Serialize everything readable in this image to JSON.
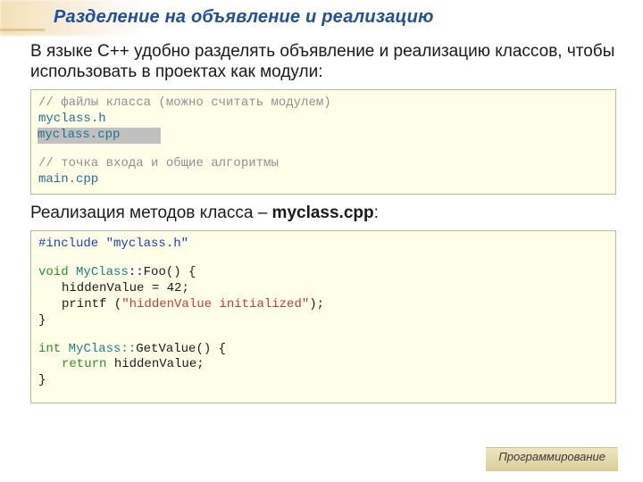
{
  "title": "Разделение на объявление и реализацию",
  "intro": "В языке С++ удобно разделять объявление и реализацию классов, чтобы использовать в проектах как модули:",
  "box1": {
    "comment1": "// файлы класса (можно считать модулем)",
    "file_h": "myclass.h",
    "file_cpp": "myclass.cpp",
    "comment2": "// точка входа и общие алгоритмы",
    "main": "main.cpp"
  },
  "mid_pre": "Реализация методов класса – ",
  "mid_bold": "myclass.cpp",
  "mid_post": ":",
  "box2": {
    "include": "#include \"myclass.h\"",
    "sig1_kw": "void",
    "sig1_class": "MyClass",
    "sig1_sep": "::",
    "sig1_fn": "Foo() {",
    "body1a_l": "hiddenValue = ",
    "body1a_n": "42",
    "body1a_r": ";",
    "body1b_fn": "printf (",
    "body1b_str": "\"hiddenValue initialized\"",
    "body1b_r": ");",
    "close1": "}",
    "sig2_kw": "int",
    "sig2_class": "MyClass::",
    "sig2_fn": "GetValue() {",
    "body2_kw": "return",
    "body2_r": " hiddenValue;",
    "close2": "}"
  },
  "footer": "Программирование"
}
